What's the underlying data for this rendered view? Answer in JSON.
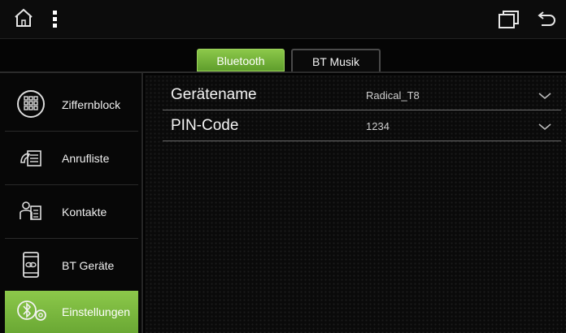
{
  "status_bar": {
    "icons": [
      "home-icon",
      "more-vertical-icon",
      "recents-icon",
      "back-icon"
    ]
  },
  "tabs": [
    {
      "label": "Bluetooth",
      "active": true
    },
    {
      "label": "BT Musik",
      "active": false
    }
  ],
  "sidebar": {
    "items": [
      {
        "label": "Ziffernblock",
        "icon": "dialpad-icon",
        "active": false
      },
      {
        "label": "Anrufliste",
        "icon": "call-log-icon",
        "active": false
      },
      {
        "label": "Kontakte",
        "icon": "contacts-icon",
        "active": false
      },
      {
        "label": "BT Geräte",
        "icon": "phone-link-icon",
        "active": false
      },
      {
        "label": "Einstellungen",
        "icon": "bluetooth-settings-icon",
        "active": true
      }
    ]
  },
  "settings": [
    {
      "label": "Gerätename",
      "value": "Radical_T8"
    },
    {
      "label": "PIN-Code",
      "value": "1234"
    }
  ],
  "colors": {
    "accent": "#7cbb3e",
    "background": "#000000",
    "divider": "#6a6a6a"
  }
}
